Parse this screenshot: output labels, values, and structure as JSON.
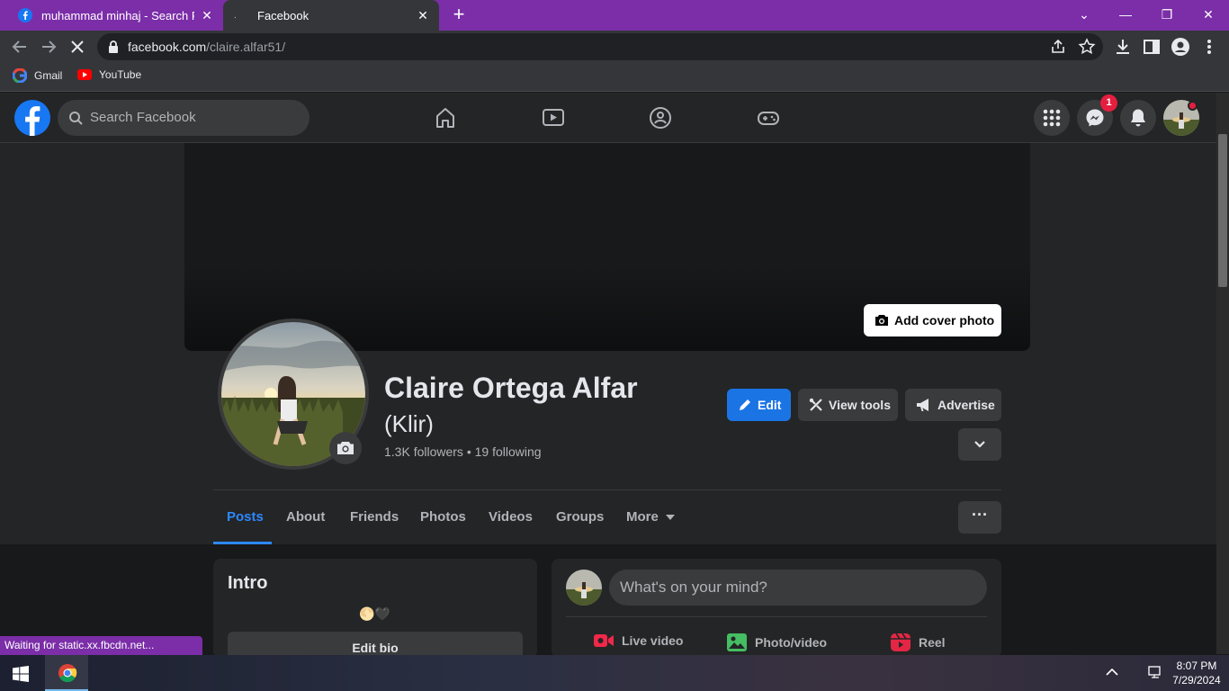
{
  "browser": {
    "tabs": [
      {
        "title": "muhammad minhaj - Search Results",
        "active": false
      },
      {
        "title": "Facebook",
        "active": true
      }
    ],
    "url_host": "facebook.com",
    "url_path": "/claire.alfar51/",
    "bookmarks": [
      "Gmail",
      "YouTube"
    ],
    "status_text": "Waiting for static.xx.fbcdn.net...",
    "accent": "#7b2ea8"
  },
  "fb_header": {
    "search_placeholder": "Search Facebook",
    "messenger_badge": "1",
    "brand_color": "#1877f2"
  },
  "profile": {
    "add_cover_label": "Add cover photo",
    "name": "Claire Ortega Alfar",
    "nickname": "(Klir)",
    "followers_line": "1.3K followers • 19 following",
    "buttons": {
      "edit": "Edit",
      "view_tools": "View tools",
      "advertise": "Advertise"
    },
    "tabs": [
      "Posts",
      "About",
      "Friends",
      "Photos",
      "Videos",
      "Groups",
      "More"
    ]
  },
  "intro": {
    "title": "Intro",
    "bio_emoji": "🌕🖤",
    "edit_bio_label": "Edit bio"
  },
  "composer": {
    "placeholder": "What's on your mind?",
    "actions": [
      "Live video",
      "Photo/video",
      "Reel"
    ]
  },
  "taskbar": {
    "time": "8:07 PM",
    "date": "7/29/2024"
  }
}
